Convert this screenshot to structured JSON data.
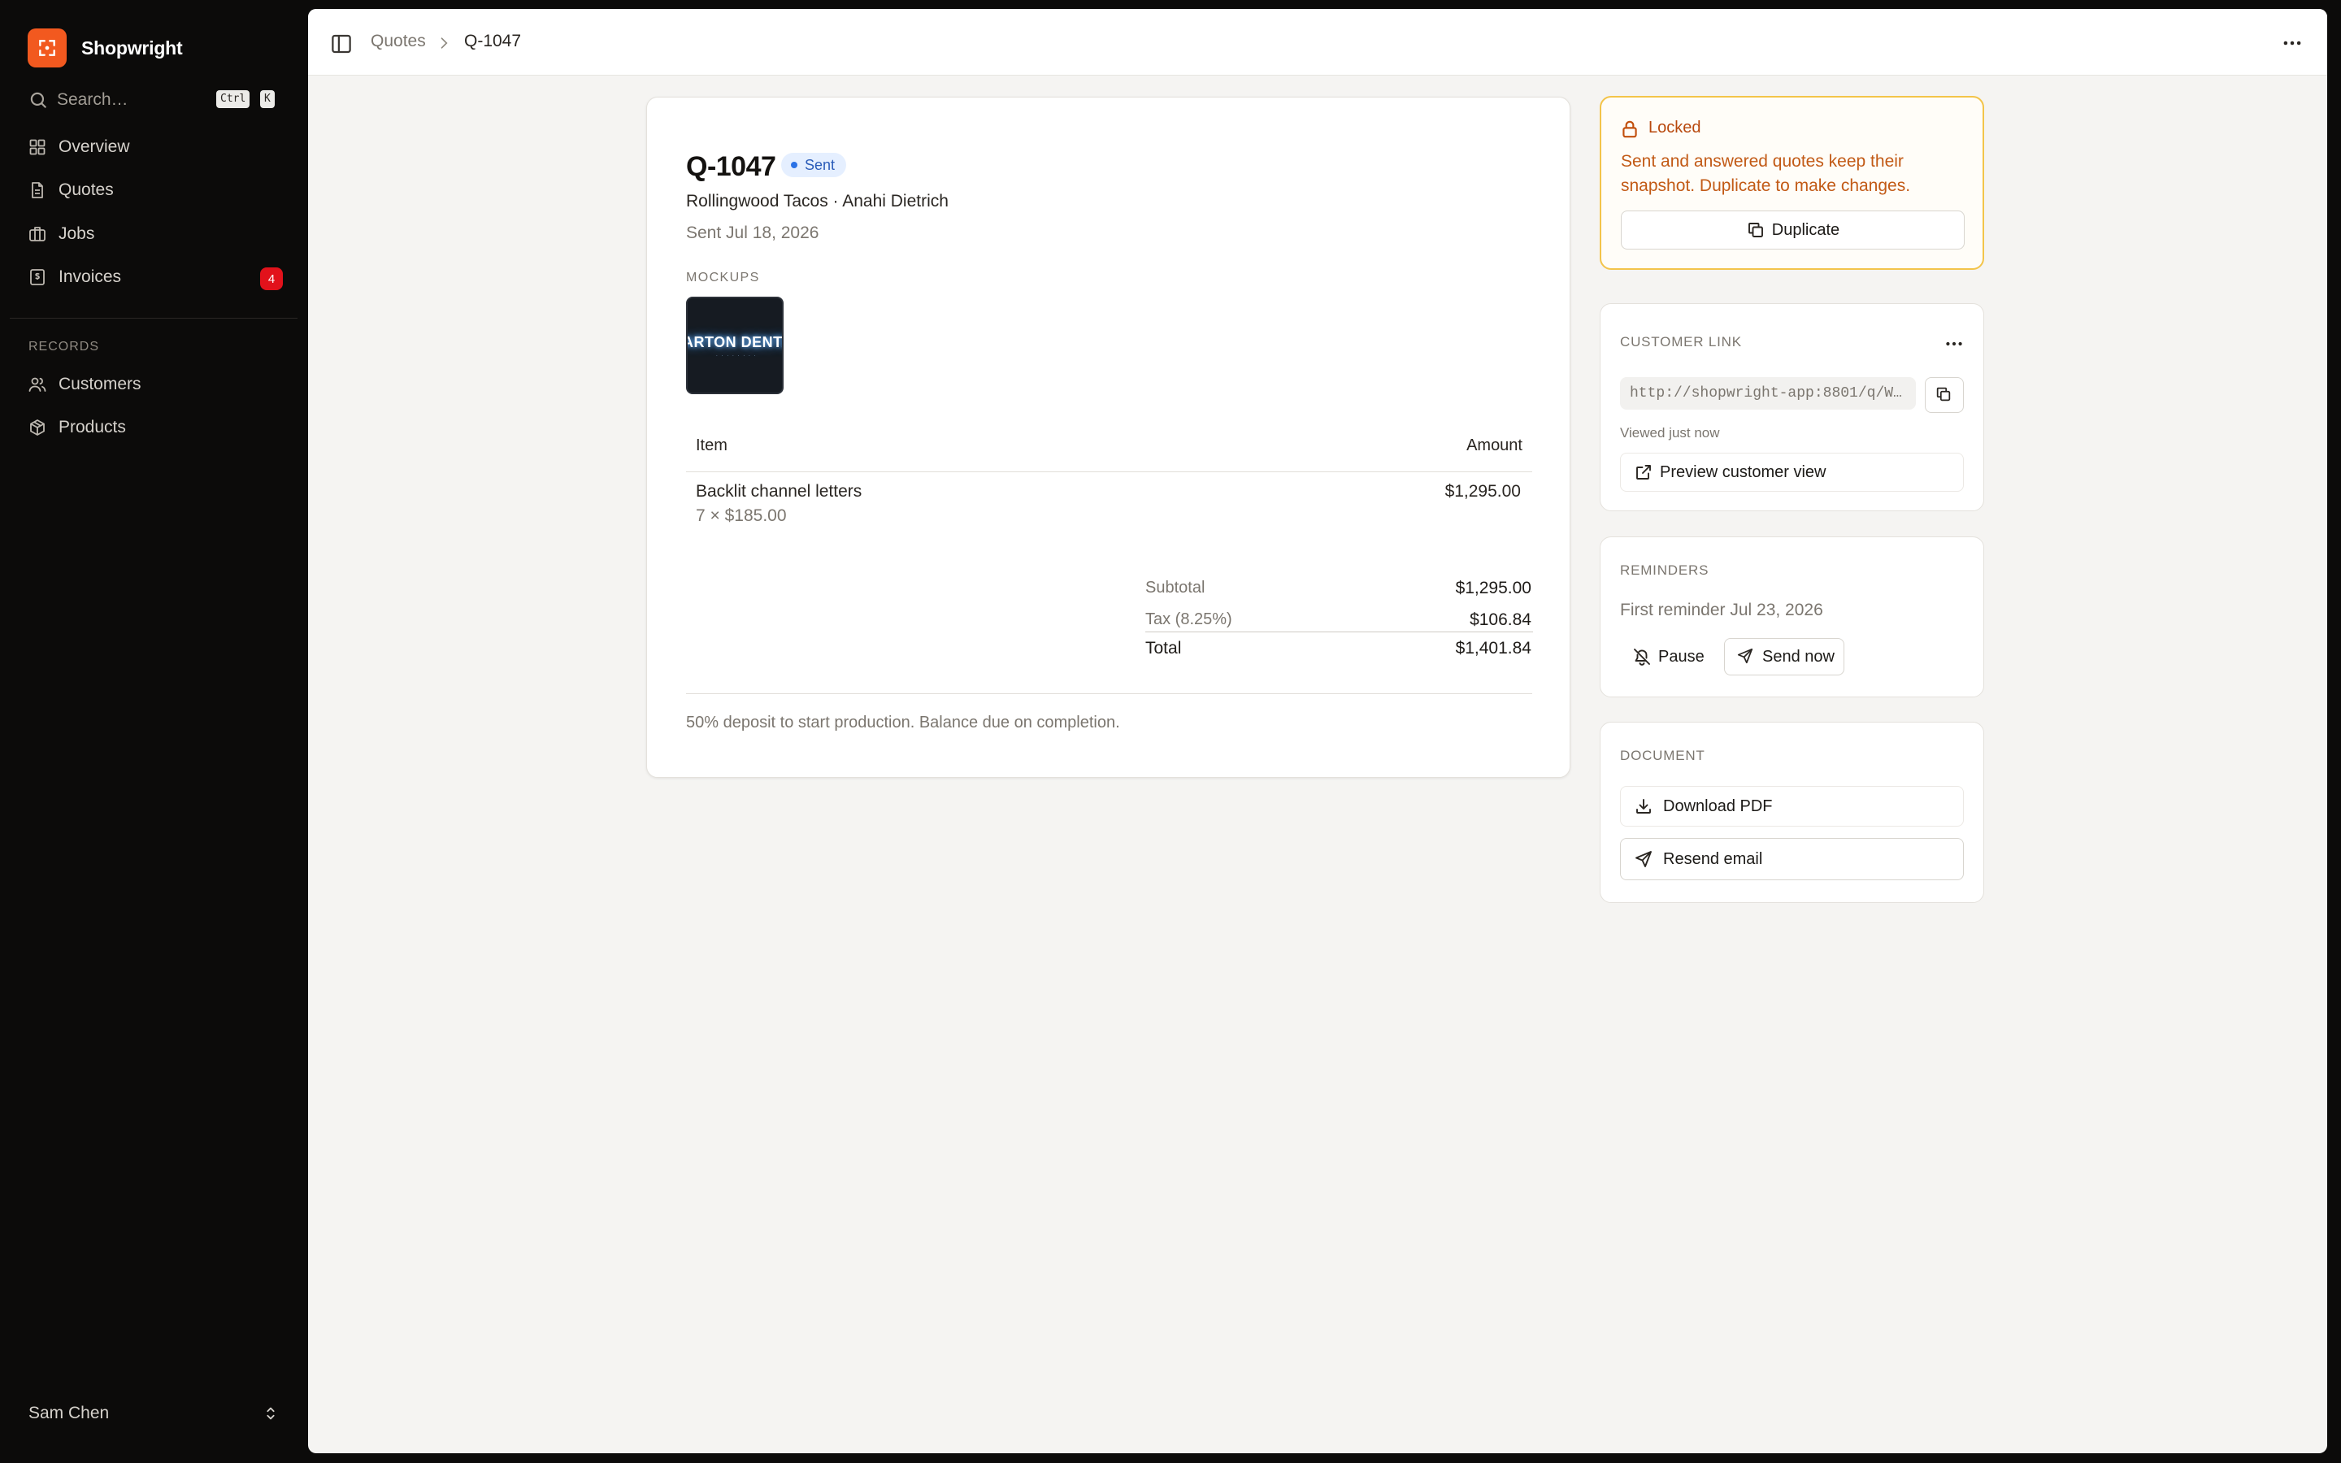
{
  "app": {
    "name": "Shopwright"
  },
  "sidebar": {
    "search": {
      "placeholder": "Search…",
      "shortcut_mod": "Ctrl",
      "shortcut_key": "K"
    },
    "items": [
      {
        "label": "Overview",
        "icon": "grid-icon"
      },
      {
        "label": "Quotes",
        "icon": "document-icon"
      },
      {
        "label": "Jobs",
        "icon": "briefcase-icon"
      },
      {
        "label": "Invoices",
        "icon": "receipt-icon",
        "badge": "4"
      }
    ],
    "records_section": "RECORDS",
    "records": [
      {
        "label": "Customers",
        "icon": "users-icon"
      },
      {
        "label": "Products",
        "icon": "box-icon"
      }
    ],
    "user": {
      "name": "Sam Chen"
    }
  },
  "breadcrumb": {
    "parent": "Quotes",
    "current": "Q-1047"
  },
  "quote": {
    "number": "Q-1047",
    "status": "Sent",
    "customer": "Rollingwood Tacos · Anahi Dietrich",
    "sent": "Sent Jul 18, 2026",
    "mockups_label": "MOCKUPS",
    "mockup_text": "ARTON DENTA",
    "table": {
      "headers": {
        "item": "Item",
        "amount": "Amount"
      },
      "rows": [
        {
          "name": "Backlit channel letters",
          "qty": "7 × $185.00",
          "amount": "$1,295.00"
        }
      ]
    },
    "totals": {
      "subtotal_label": "Subtotal",
      "subtotal": "$1,295.00",
      "tax_label": "Tax (8.25%)",
      "tax": "$106.84",
      "total_label": "Total",
      "total": "$1,401.84"
    },
    "note": "50% deposit to start production. Balance due on completion."
  },
  "locked": {
    "title": "Locked",
    "message": "Sent and answered quotes keep their snapshot. Duplicate to make changes.",
    "duplicate": "Duplicate"
  },
  "customer_link": {
    "label": "CUSTOMER LINK",
    "url": "http://shopwright-app:8801/q/W…",
    "viewed": "Viewed just now",
    "preview": "Preview customer view"
  },
  "reminders": {
    "label": "REMINDERS",
    "text": "First reminder Jul 23, 2026",
    "pause": "Pause",
    "send_now": "Send now"
  },
  "document": {
    "label": "DOCUMENT",
    "download": "Download PDF",
    "resend": "Resend email"
  },
  "colors": {
    "brand": "#f2591f",
    "sidebar_bg": "#0c0b0a",
    "badge": "#e2121b",
    "status_sent_bg": "#e5efff",
    "locked_border": "#f3c44a",
    "locked_text": "#c25a16"
  }
}
